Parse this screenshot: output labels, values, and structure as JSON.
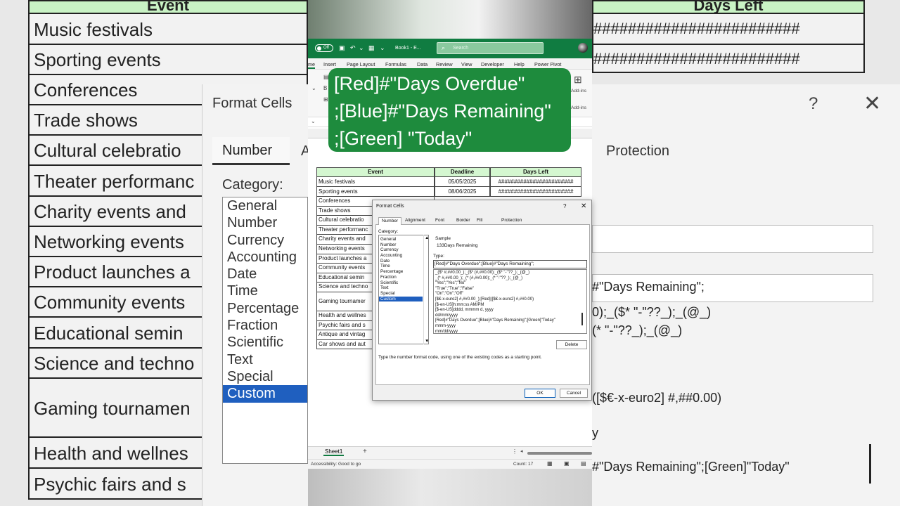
{
  "bg_left": {
    "header": "Event",
    "rows": [
      "Music festivals",
      "Sporting events",
      "Conferences",
      "Trade shows",
      "Cultural celebratio",
      "Theater performanc",
      "Charity events and",
      "Networking events",
      "Product launches a",
      "Community events",
      "Educational semin",
      "Science and techno",
      "Gaming tournamen",
      "Health and wellnes",
      "Psychic fairs and s"
    ],
    "dialog_title": "Format Cells",
    "tab_number": "Number",
    "tab_next": "A",
    "category_label": "Category:",
    "categories": [
      "General",
      "Number",
      "Currency",
      "Accounting",
      "Date",
      "Time",
      "Percentage",
      "Fraction",
      "Scientific",
      "Text",
      "Special",
      "Custom"
    ]
  },
  "bg_right": {
    "header": "Days Left",
    "hash_row": "########################",
    "tab_protection": "Protection",
    "q": "?",
    "x": "✕",
    "texts": [
      "#\"Days Remaining\";",
      "0);_($* \"-\"??_);_(@_)",
      "(* \"-\"??_);_(@_)",
      "([$€-x-euro2] #,##0.00)",
      "y",
      "#\"Days Remaining\";[Green]\"Today\""
    ]
  },
  "titlebar": {
    "autosave": "Off",
    "file": "Book1 - E...",
    "search_placeholder": "Search"
  },
  "menu": [
    "me",
    "Insert",
    "Page Layout",
    "Formulas",
    "Data",
    "Review",
    "View",
    "Developer",
    "Help",
    "Power Pivot"
  ],
  "ribbon": {
    "addins1": "Add-ins",
    "addins2": "Add-ins"
  },
  "overlay": {
    "line1": "[Red]#\"Days Overdue\"",
    "line2": ";[Blue]#\"Days Remaining\"",
    "line3": ";[Green] \"Today\""
  },
  "sheet": {
    "headers": [
      "Event",
      "Deadline",
      "Days Left"
    ],
    "rows": [
      [
        "Music festivals",
        "05/05/2025",
        "########################"
      ],
      [
        "Sporting events",
        "08/06/2025",
        "########################"
      ],
      [
        "Conferences",
        "",
        ""
      ],
      [
        "Trade shows",
        "",
        ""
      ],
      [
        "Cultural celebratio",
        "",
        ""
      ],
      [
        "Theater performanc",
        "",
        ""
      ],
      [
        "Charity events and",
        "",
        ""
      ],
      [
        "Networking events",
        "",
        ""
      ],
      [
        "Product launches a",
        "",
        ""
      ],
      [
        "Community events",
        "",
        ""
      ],
      [
        "Educational semin",
        "",
        ""
      ],
      [
        "Science and techno",
        "",
        ""
      ],
      [
        "Gaming tournamer",
        "",
        ""
      ],
      [
        "Health and wellnes",
        "",
        ""
      ],
      [
        "Psychic fairs and s",
        "",
        ""
      ],
      [
        "Antique and vintag",
        "",
        ""
      ],
      [
        "Car shows and aut",
        "",
        ""
      ]
    ]
  },
  "sheet_tab": "Sheet1",
  "status": {
    "accessibility": "Accessibility: Good to go",
    "count": "Count: 17"
  },
  "dialog": {
    "title": "Format Cells",
    "help": "?",
    "close": "✕",
    "tabs": [
      "Number",
      "Alignment",
      "Font",
      "Border",
      "Fill",
      "Protection"
    ],
    "category_label": "Category:",
    "categories": [
      "General",
      "Number",
      "Currency",
      "Accounting",
      "Date",
      "Time",
      "Percentage",
      "Fraction",
      "Scientific",
      "Text",
      "Special",
      "Custom"
    ],
    "selected_category": "Custom",
    "sample_label": "Sample",
    "sample_value": "133Days Remaining",
    "type_label": "Type:",
    "type_value": "[Red]#\"Days Overdue\";[Blue]#\"Days Remaining\";",
    "type_list": [
      "_($* #,##0.00_);_($* (#,##0.00);_($* \"-\"??_);_(@_)",
      "_(* #,##0.00_);_(* (#,##0.00);_(* \"-\"??_);_(@_)",
      "\"Yes\";\"Yes\";\"No\"",
      "\"True\";\"True\";\"False\"",
      "\"On\";\"On\";\"Off\"",
      "[$€-x-euro2] #,##0.00_);[Red]([$€-x-euro2] #,##0.00)",
      "[$-en-US]h:mm:ss AM/PM",
      "[$-en-US]dddd, mmmm d, yyyy",
      "dd/mm/yyyy",
      "[Red]#\"Days Overdue\";[Blue]#\"Days Remaining\";[Green]\"Today\"",
      "mmm-yyyy",
      "mm/dd/yyyy"
    ],
    "delete": "Delete",
    "hint": "Type the number format code, using one of the existing codes as a starting point.",
    "ok": "OK",
    "cancel": "Cancel"
  }
}
